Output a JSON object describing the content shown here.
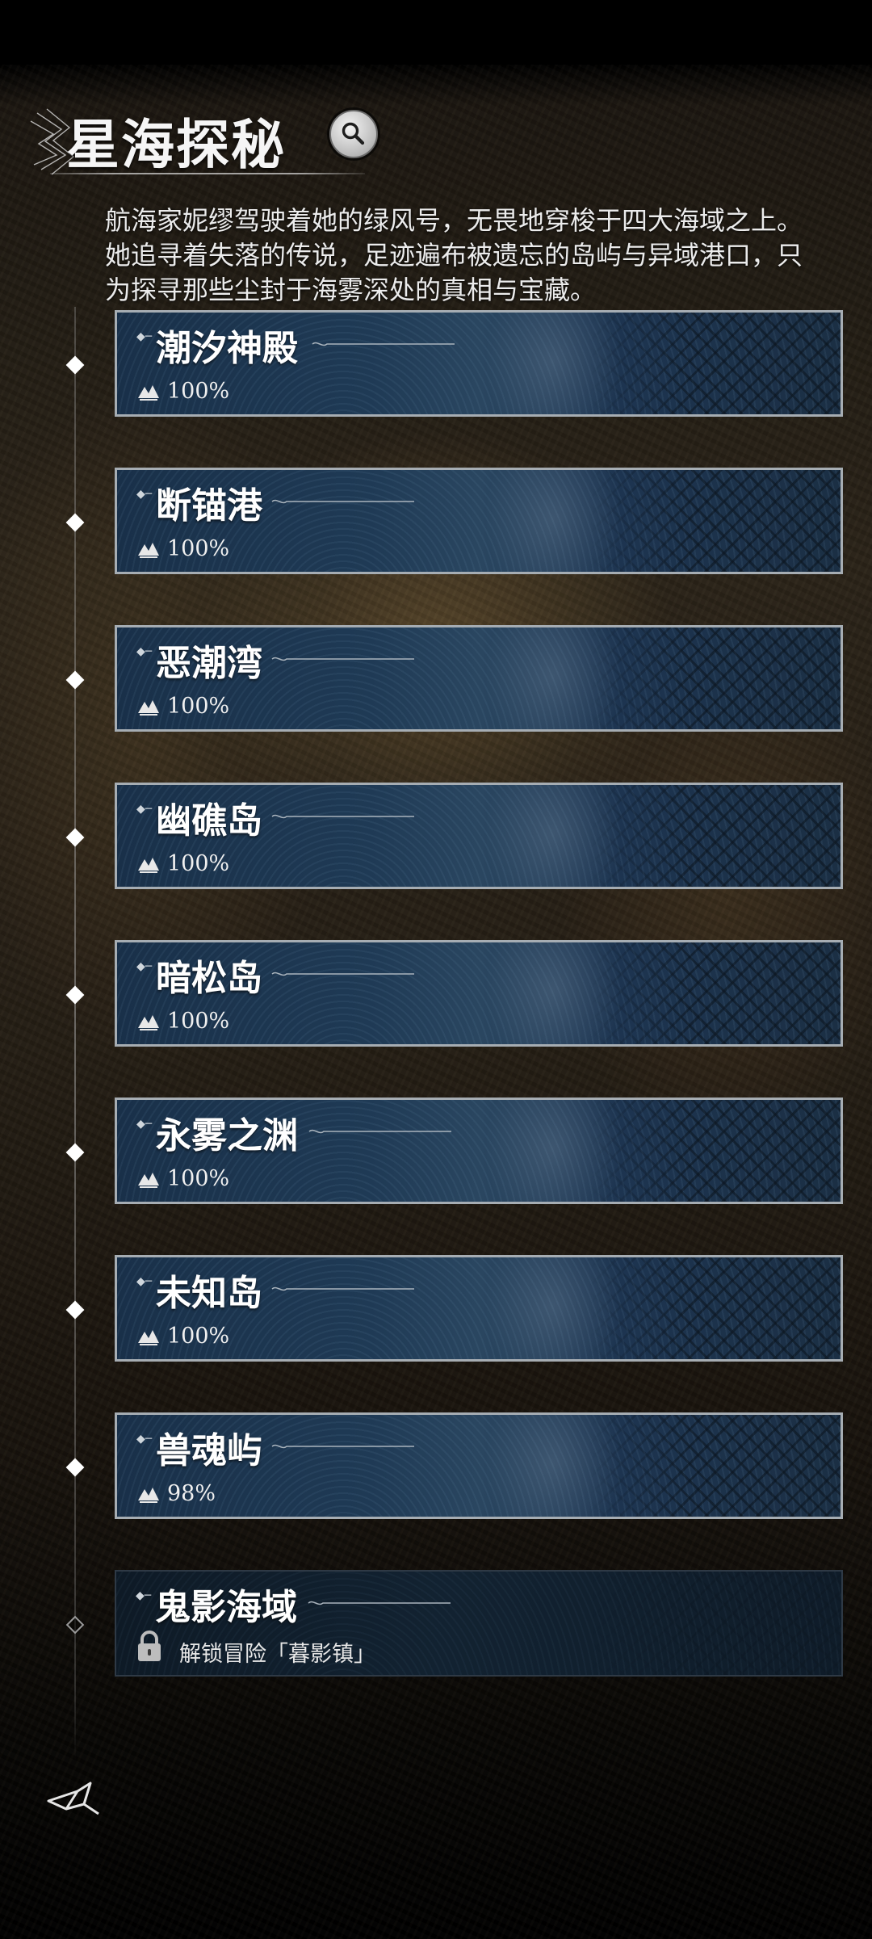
{
  "header": {
    "title": "星海探秘",
    "search_icon": "search-icon"
  },
  "description": "航海家妮缪驾驶着她的绿风号，无畏地穿梭于四大海域之上。她追寻着失落的传说，足迹遍布被遗忘的岛屿与异域港口，只为探寻那些尘封于海雾深处的真相与宝藏。",
  "regions": [
    {
      "name": "潮汐神殿",
      "progress": "100%",
      "locked": false
    },
    {
      "name": "断锚港",
      "progress": "100%",
      "locked": false
    },
    {
      "name": "恶潮湾",
      "progress": "100%",
      "locked": false
    },
    {
      "name": "幽礁岛",
      "progress": "100%",
      "locked": false
    },
    {
      "name": "暗松岛",
      "progress": "100%",
      "locked": false
    },
    {
      "name": "永雾之渊",
      "progress": "100%",
      "locked": false
    },
    {
      "name": "未知岛",
      "progress": "100%",
      "locked": false
    },
    {
      "name": "兽魂屿",
      "progress": "98%",
      "locked": false
    },
    {
      "name": "鬼影海域",
      "unlock_hint": "解锁冒险「暮影镇」",
      "locked": true
    }
  ],
  "colors": {
    "card_border": "#a6adb3",
    "card_bg": "#1f3a55",
    "text": "#f2f2f2"
  }
}
